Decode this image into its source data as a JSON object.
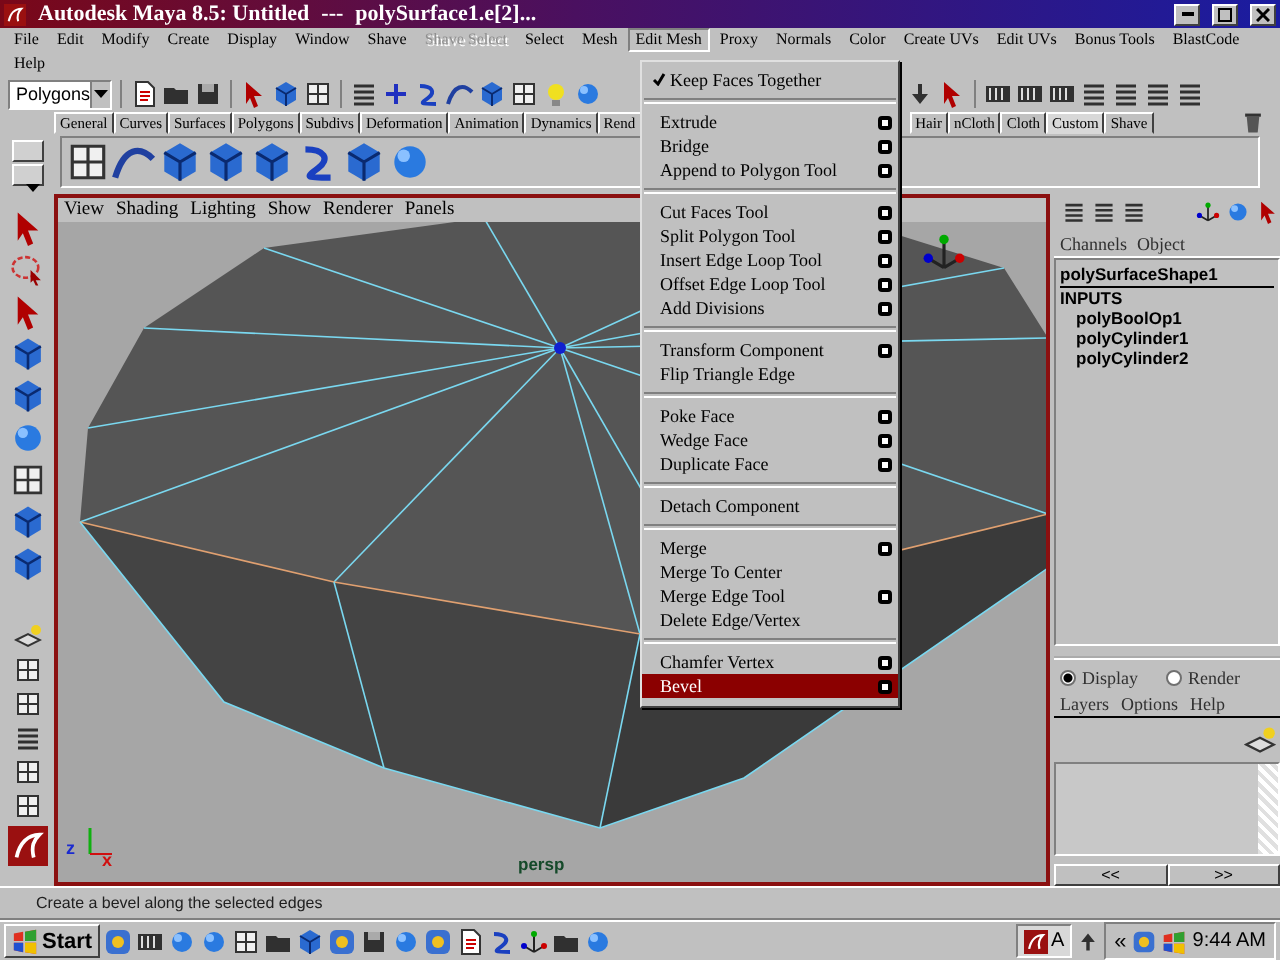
{
  "window": {
    "title": "Autodesk Maya 8.5: Untitled",
    "separator": "---",
    "selection": "polySurface1.e[2]..."
  },
  "menubar": [
    {
      "label": "File",
      "disabled": false,
      "selected": false
    },
    {
      "label": "Edit",
      "disabled": false,
      "selected": false
    },
    {
      "label": "Modify",
      "disabled": false,
      "selected": false
    },
    {
      "label": "Create",
      "disabled": false,
      "selected": false
    },
    {
      "label": "Display",
      "disabled": false,
      "selected": false
    },
    {
      "label": "Window",
      "disabled": false,
      "selected": false
    },
    {
      "label": "Shave",
      "disabled": false,
      "selected": false
    },
    {
      "label": "Shave Select",
      "disabled": true,
      "selected": false
    },
    {
      "label": "Select",
      "disabled": false,
      "selected": false
    },
    {
      "label": "Mesh",
      "disabled": false,
      "selected": false
    },
    {
      "label": "Edit Mesh",
      "disabled": false,
      "selected": true
    },
    {
      "label": "Proxy",
      "disabled": false,
      "selected": false
    },
    {
      "label": "Normals",
      "disabled": false,
      "selected": false
    },
    {
      "label": "Color",
      "disabled": false,
      "selected": false
    },
    {
      "label": "Create UVs",
      "disabled": false,
      "selected": false
    },
    {
      "label": "Edit UVs",
      "disabled": false,
      "selected": false
    },
    {
      "label": "Bonus Tools",
      "disabled": false,
      "selected": false
    },
    {
      "label": "BlastCode",
      "disabled": false,
      "selected": false
    },
    {
      "label": "Help",
      "disabled": false,
      "selected": false
    }
  ],
  "status_line": {
    "mode": "Polygons"
  },
  "shelf": {
    "tabs": [
      {
        "label": "General",
        "selected": false,
        "clipped": false
      },
      {
        "label": "Curves",
        "selected": false,
        "clipped": false
      },
      {
        "label": "Surfaces",
        "selected": false,
        "clipped": false
      },
      {
        "label": "Polygons",
        "selected": false,
        "clipped": false
      },
      {
        "label": "Subdivs",
        "selected": false,
        "clipped": false
      },
      {
        "label": "Deformation",
        "selected": false,
        "clipped": false
      },
      {
        "label": "Animation",
        "selected": false,
        "clipped": false
      },
      {
        "label": "Dynamics",
        "selected": false,
        "clipped": false
      },
      {
        "label": "Rend",
        "selected": false,
        "clipped": true
      },
      {
        "label": "Hair",
        "selected": false,
        "clipped": false
      },
      {
        "label": "nCloth",
        "selected": false,
        "clipped": false
      },
      {
        "label": "Cloth",
        "selected": false,
        "clipped": false
      },
      {
        "label": "Custom",
        "selected": true,
        "clipped": false
      },
      {
        "label": "Shave",
        "selected": false,
        "clipped": false
      }
    ]
  },
  "viewport": {
    "menus": [
      "View",
      "Shading",
      "Lighting",
      "Show",
      "Renderer",
      "Panels"
    ],
    "camera": "persp",
    "axis_labels": [
      "z",
      "x"
    ]
  },
  "edit_mesh_menu": {
    "items": [
      {
        "kind": "check",
        "label": "Keep Faces Together",
        "checked": true,
        "selected": false
      },
      {
        "kind": "separator"
      },
      {
        "kind": "item",
        "label": "Extrude",
        "option_box": true,
        "selected": false
      },
      {
        "kind": "item",
        "label": "Bridge",
        "option_box": true,
        "selected": false
      },
      {
        "kind": "item",
        "label": "Append to Polygon Tool",
        "option_box": true,
        "selected": false
      },
      {
        "kind": "separator"
      },
      {
        "kind": "item",
        "label": "Cut Faces Tool",
        "option_box": true,
        "selected": false
      },
      {
        "kind": "item",
        "label": "Split Polygon Tool",
        "option_box": true,
        "selected": false
      },
      {
        "kind": "item",
        "label": "Insert Edge Loop Tool",
        "option_box": true,
        "selected": false
      },
      {
        "kind": "item",
        "label": "Offset Edge Loop Tool",
        "option_box": true,
        "selected": false
      },
      {
        "kind": "item",
        "label": "Add Divisions",
        "option_box": true,
        "selected": false
      },
      {
        "kind": "separator"
      },
      {
        "kind": "item",
        "label": "Transform Component",
        "option_box": true,
        "selected": false
      },
      {
        "kind": "item",
        "label": "Flip Triangle Edge",
        "option_box": false,
        "selected": false
      },
      {
        "kind": "separator"
      },
      {
        "kind": "item",
        "label": "Poke Face",
        "option_box": true,
        "selected": false
      },
      {
        "kind": "item",
        "label": "Wedge Face",
        "option_box": true,
        "selected": false
      },
      {
        "kind": "item",
        "label": "Duplicate Face",
        "option_box": true,
        "selected": false
      },
      {
        "kind": "separator"
      },
      {
        "kind": "item",
        "label": "Detach Component",
        "option_box": false,
        "selected": false
      },
      {
        "kind": "separator"
      },
      {
        "kind": "item",
        "label": "Merge",
        "option_box": true,
        "selected": false
      },
      {
        "kind": "item",
        "label": "Merge To Center",
        "option_box": false,
        "selected": false
      },
      {
        "kind": "item",
        "label": "Merge Edge Tool",
        "option_box": true,
        "selected": false
      },
      {
        "kind": "item",
        "label": "Delete Edge/Vertex",
        "option_box": false,
        "selected": false
      },
      {
        "kind": "separator"
      },
      {
        "kind": "item",
        "label": "Chamfer Vertex",
        "option_box": true,
        "selected": false
      },
      {
        "kind": "item",
        "label": "Bevel",
        "option_box": true,
        "selected": true
      }
    ]
  },
  "channel_box": {
    "menus": [
      "Channels",
      "Object"
    ],
    "node": "polySurfaceShape1",
    "inputs_label": "INPUTS",
    "inputs": [
      "polyBoolOp1",
      "polyCylinder1",
      "polyCylinder2"
    ]
  },
  "layer_editor": {
    "modes": [
      {
        "label": "Display",
        "selected": true
      },
      {
        "label": "Render",
        "selected": false
      }
    ],
    "menus": [
      "Layers",
      "Options",
      "Help"
    ],
    "buttons": [
      "<<",
      ">>"
    ]
  },
  "help_line": "Create a bevel along the selected edges",
  "taskbar": {
    "start": "Start",
    "tray_label": "A",
    "chevron": "«",
    "clock": "9:44 AM"
  }
}
